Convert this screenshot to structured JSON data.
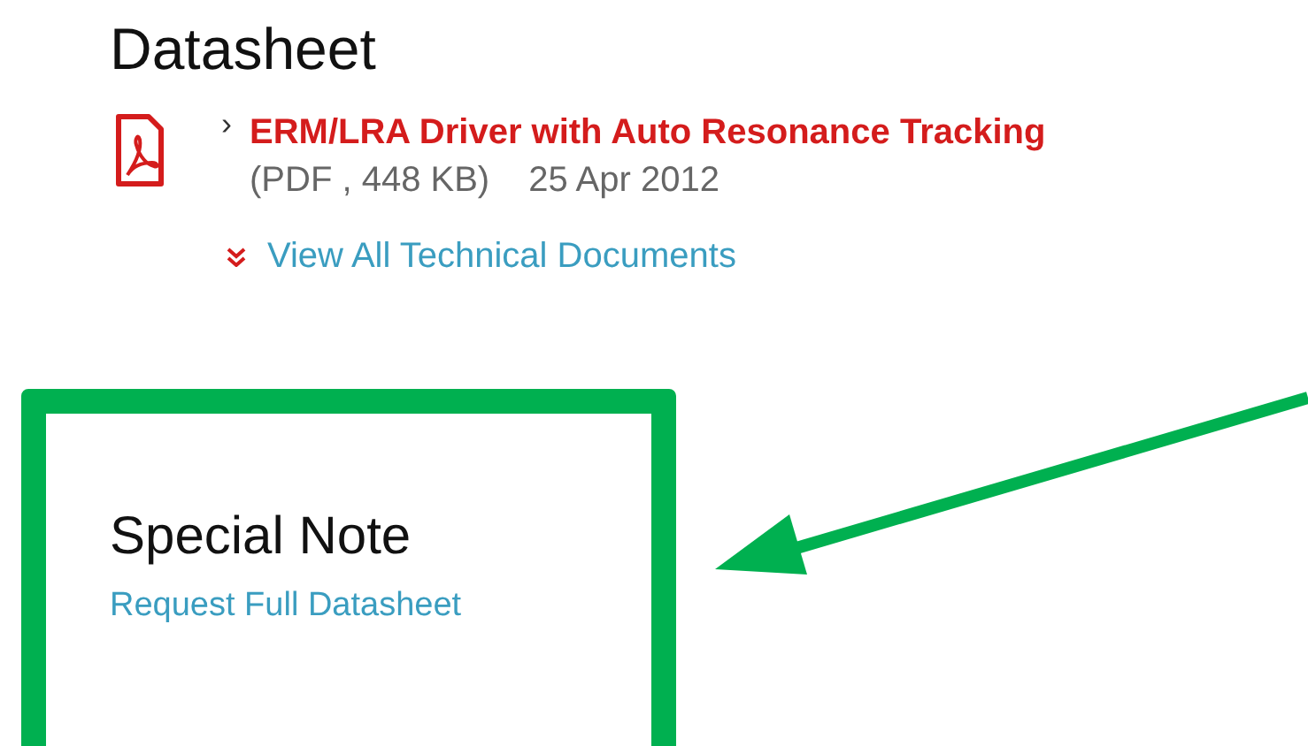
{
  "datasheet": {
    "heading": "Datasheet",
    "document": {
      "bullet": "›",
      "title": "ERM/LRA Driver with Auto Resonance Tracking",
      "meta": "(PDF , 448 KB)",
      "date": "25 Apr 2012"
    },
    "view_all": "View All Technical Documents"
  },
  "special_note": {
    "heading": "Special Note",
    "link": "Request Full Datasheet",
    "highlighted": true
  }
}
